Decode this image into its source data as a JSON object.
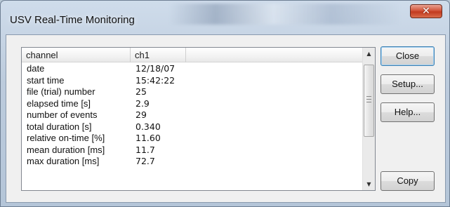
{
  "window": {
    "title": "USV Real-Time Monitoring",
    "close_glyph": "✕"
  },
  "listview": {
    "columns": [
      "channel",
      "ch1"
    ],
    "rows": [
      [
        "date",
        "12/18/07"
      ],
      [
        "start time",
        "15:42:22"
      ],
      [
        "file (trial) number",
        "25"
      ],
      [
        "elapsed time [s]",
        "2.9"
      ],
      [
        "number of events",
        "29"
      ],
      [
        "total duration [s]",
        "0.340"
      ],
      [
        "relative on-time [%]",
        "11.60"
      ],
      [
        "mean duration [ms]",
        "11.7"
      ],
      [
        "max duration [ms]",
        "72.7"
      ]
    ],
    "scroll_up_glyph": "▲",
    "scroll_down_glyph": "▼"
  },
  "buttons": {
    "close": "Close",
    "setup": "Setup...",
    "help": "Help...",
    "copy": "Copy"
  }
}
